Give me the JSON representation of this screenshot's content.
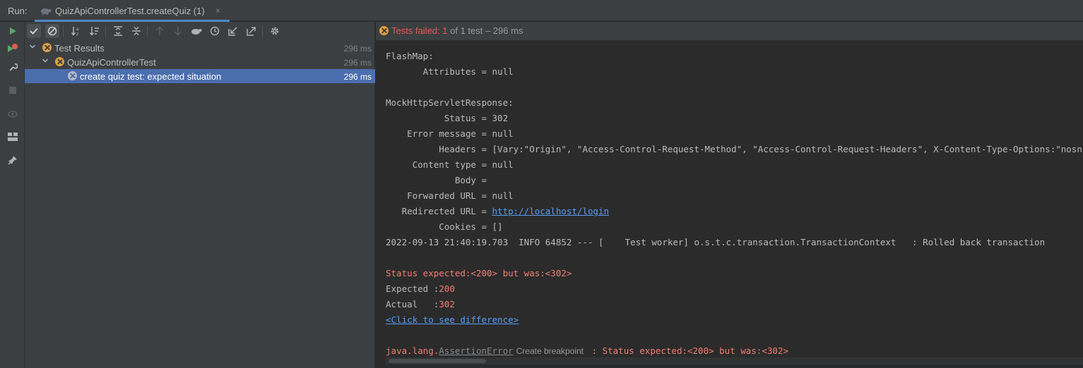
{
  "runbar": {
    "label": "Run:",
    "tab_title": "QuizApiControllerTest.createQuiz (1)",
    "tab_close": "×"
  },
  "vtoolbar": {
    "icons": [
      "rerun-icon",
      "rerun-failed-icon",
      "wrench-icon",
      "stop-icon",
      "eye-icon",
      "layout-icon",
      "pin-icon"
    ]
  },
  "tree_toolbar": {
    "icons": [
      "show-passed-icon",
      "show-ignored-icon",
      "sort-alpha-icon",
      "sort-duration-icon",
      "expand-all-icon",
      "collapse-all-icon",
      "prev-failed-icon",
      "next-failed-icon",
      "import-icon",
      "history-icon",
      "export-in-icon",
      "export-out-icon",
      "settings-icon"
    ]
  },
  "tree": {
    "rows": [
      {
        "label": "Test Results",
        "time": "296 ms"
      },
      {
        "label": "QuizApiControllerTest",
        "time": "296 ms"
      },
      {
        "label": "create quiz test: expected situation",
        "time": "296 ms"
      }
    ]
  },
  "status": {
    "prefix": "Tests failed: ",
    "failed_count": "1",
    "suffix": " of 1 test – 296 ms"
  },
  "console": {
    "l1": "FlashMap:",
    "l2": "       Attributes = null",
    "l3": "",
    "l4": "MockHttpServletResponse:",
    "l5": "           Status = 302",
    "l6": "    Error message = null",
    "l7": "          Headers = [Vary:\"Origin\", \"Access-Control-Request-Method\", \"Access-Control-Request-Headers\", X-Content-Type-Options:\"nosniff\"]",
    "l8": "     Content type = null",
    "l9": "             Body = ",
    "l10": "    Forwarded URL = null",
    "l11_prefix": "   Redirected URL = ",
    "l11_link": "http://localhost/login",
    "l12": "          Cookies = []",
    "l13": "2022-09-13 21:40:19.703  INFO 64852 --- [    Test worker] o.s.t.c.transaction.TransactionContext   : Rolled back transaction",
    "l14": "Status expected:<200> but was:<302>",
    "expected_label": "Expected :",
    "expected_value": "200",
    "actual_label": "Actual   :",
    "actual_value": "302",
    "diff_link": "<Click to see difference>",
    "err_prefix": "java.lang.",
    "err_class": "AssertionError",
    "tooltip": "Create breakpoint",
    "err_msg": " : Status expected:<200> but was:<302>"
  }
}
